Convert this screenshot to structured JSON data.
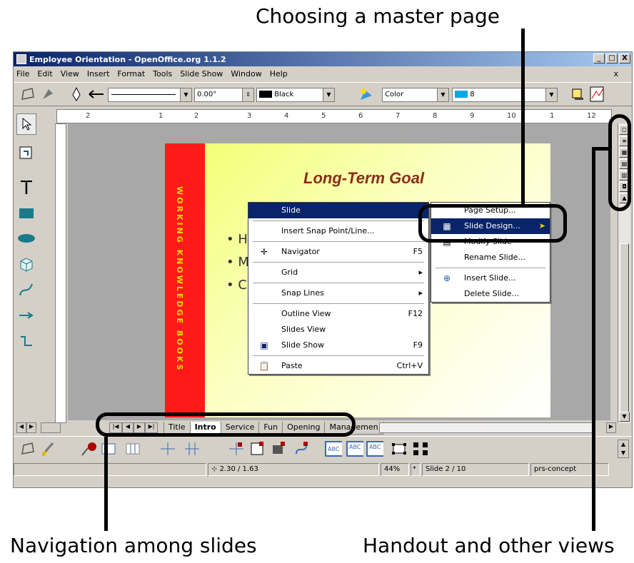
{
  "callouts": {
    "master": "Choosing a master page",
    "navigation": "Navigation among slides",
    "handout": "Handout and other views"
  },
  "window": {
    "title": "Employee Orientation - OpenOffice.org 1.1.2",
    "min": "_",
    "max": "□",
    "close": "X",
    "doc_close": "x"
  },
  "menu": [
    "File",
    "Edit",
    "View",
    "Insert",
    "Format",
    "Tools",
    "Slide Show",
    "Window",
    "Help"
  ],
  "toolbar": {
    "angle": "0.00°",
    "line_color": "Black",
    "area_style": "Color",
    "area_value": "8"
  },
  "ruler_ticks": [
    "2",
    "1",
    "2",
    "3",
    "4",
    "5",
    "6",
    "7",
    "8",
    "9",
    "10",
    "1",
    "12"
  ],
  "slide": {
    "title": "Long-Term Goal",
    "side_text": "WORKING KNOWLEDGE BOOKS",
    "bullets": [
      "H",
      "M",
      "C"
    ]
  },
  "context_menu": {
    "items": [
      {
        "label": "Slide",
        "accel": "",
        "icon": "",
        "selected": true,
        "arrow": true
      },
      {
        "label": "Insert Snap Point/Line...",
        "accel": "",
        "icon": ""
      },
      {
        "label": "Navigator",
        "accel": "F5",
        "icon": "navigator-icon"
      },
      {
        "label": "Grid",
        "accel": "▸",
        "icon": ""
      },
      {
        "label": "Snap Lines",
        "accel": "▸",
        "icon": ""
      },
      {
        "label": "Outline View",
        "accel": "F12",
        "icon": ""
      },
      {
        "label": "Slides View",
        "accel": "",
        "icon": ""
      },
      {
        "label": "Slide Show",
        "accel": "F9",
        "icon": "slideshow-icon"
      },
      {
        "label": "Paste",
        "accel": "Ctrl+V",
        "icon": "paste-icon"
      }
    ]
  },
  "submenu": {
    "items": [
      {
        "label": "Page Setup...",
        "selected": false
      },
      {
        "label": "Slide Design...",
        "selected": true
      },
      {
        "label": "Modify Slide",
        "selected": false
      },
      {
        "label": "Rename Slide...",
        "selected": false
      },
      {
        "label": "Insert Slide...",
        "selected": false
      },
      {
        "label": "Delete Slide...",
        "selected": false
      }
    ]
  },
  "tabs": [
    "Title",
    "Intro",
    "Service",
    "Fun",
    "Opening",
    "Managemen"
  ],
  "active_tab": "Intro",
  "status": {
    "position": "2.30 / 1.63",
    "zoom": "44%",
    "page": "Slide 2 / 10",
    "master": "prs-concept"
  }
}
